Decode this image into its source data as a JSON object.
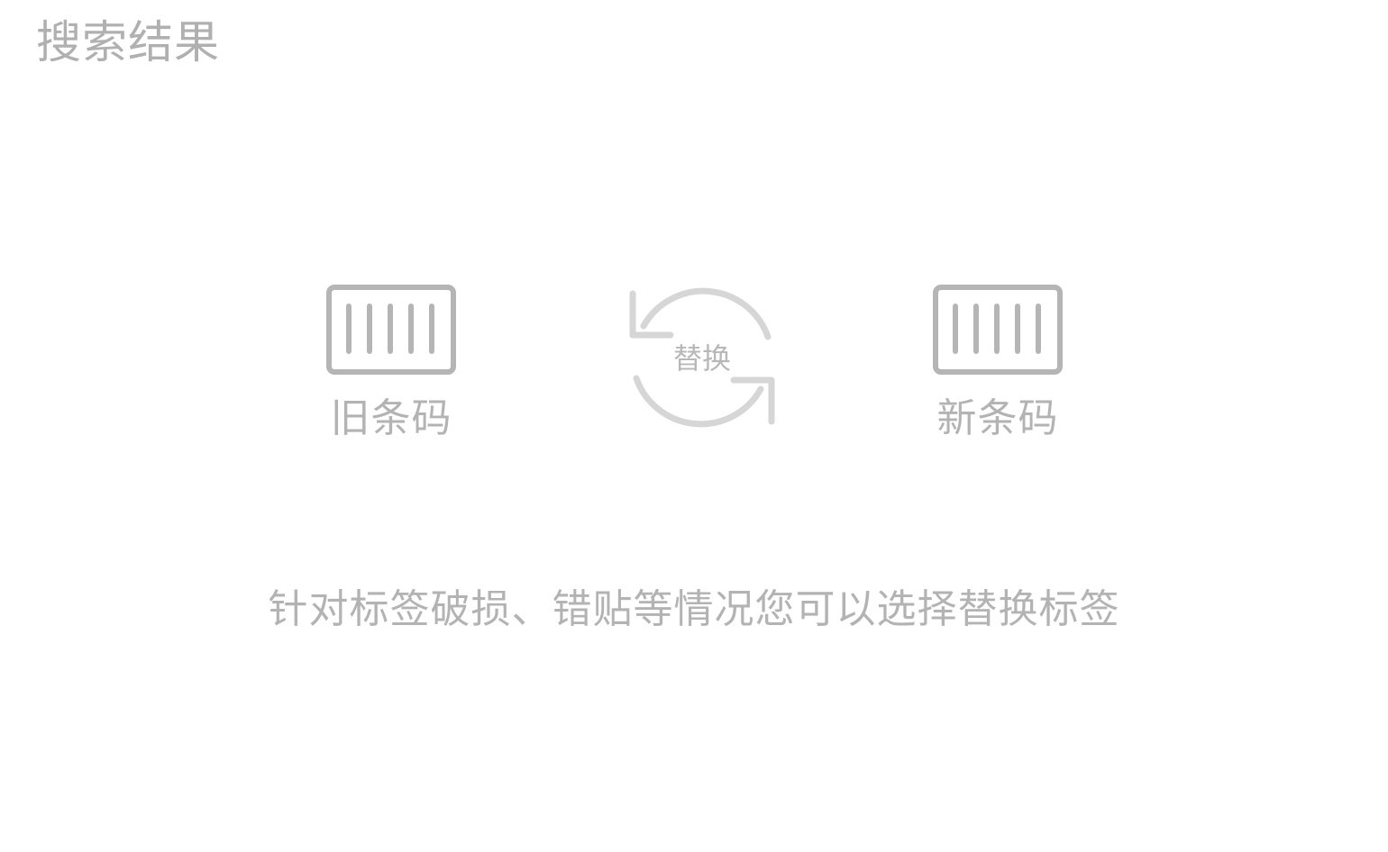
{
  "header": {
    "title": "搜索结果"
  },
  "replace": {
    "old_barcode": {
      "label": "旧条码",
      "icon": "barcode-icon"
    },
    "swap": {
      "label": "替换",
      "icon": "refresh-icon"
    },
    "new_barcode": {
      "label": "新条码",
      "icon": "barcode-icon"
    }
  },
  "hint": "针对标签破损、错贴等情况您可以选择替换标签",
  "colors": {
    "text": "#b3b3b3",
    "barcode_icon": "#b5b5b5",
    "swap_icon": "#d6d6d6",
    "background": "#ffffff"
  }
}
